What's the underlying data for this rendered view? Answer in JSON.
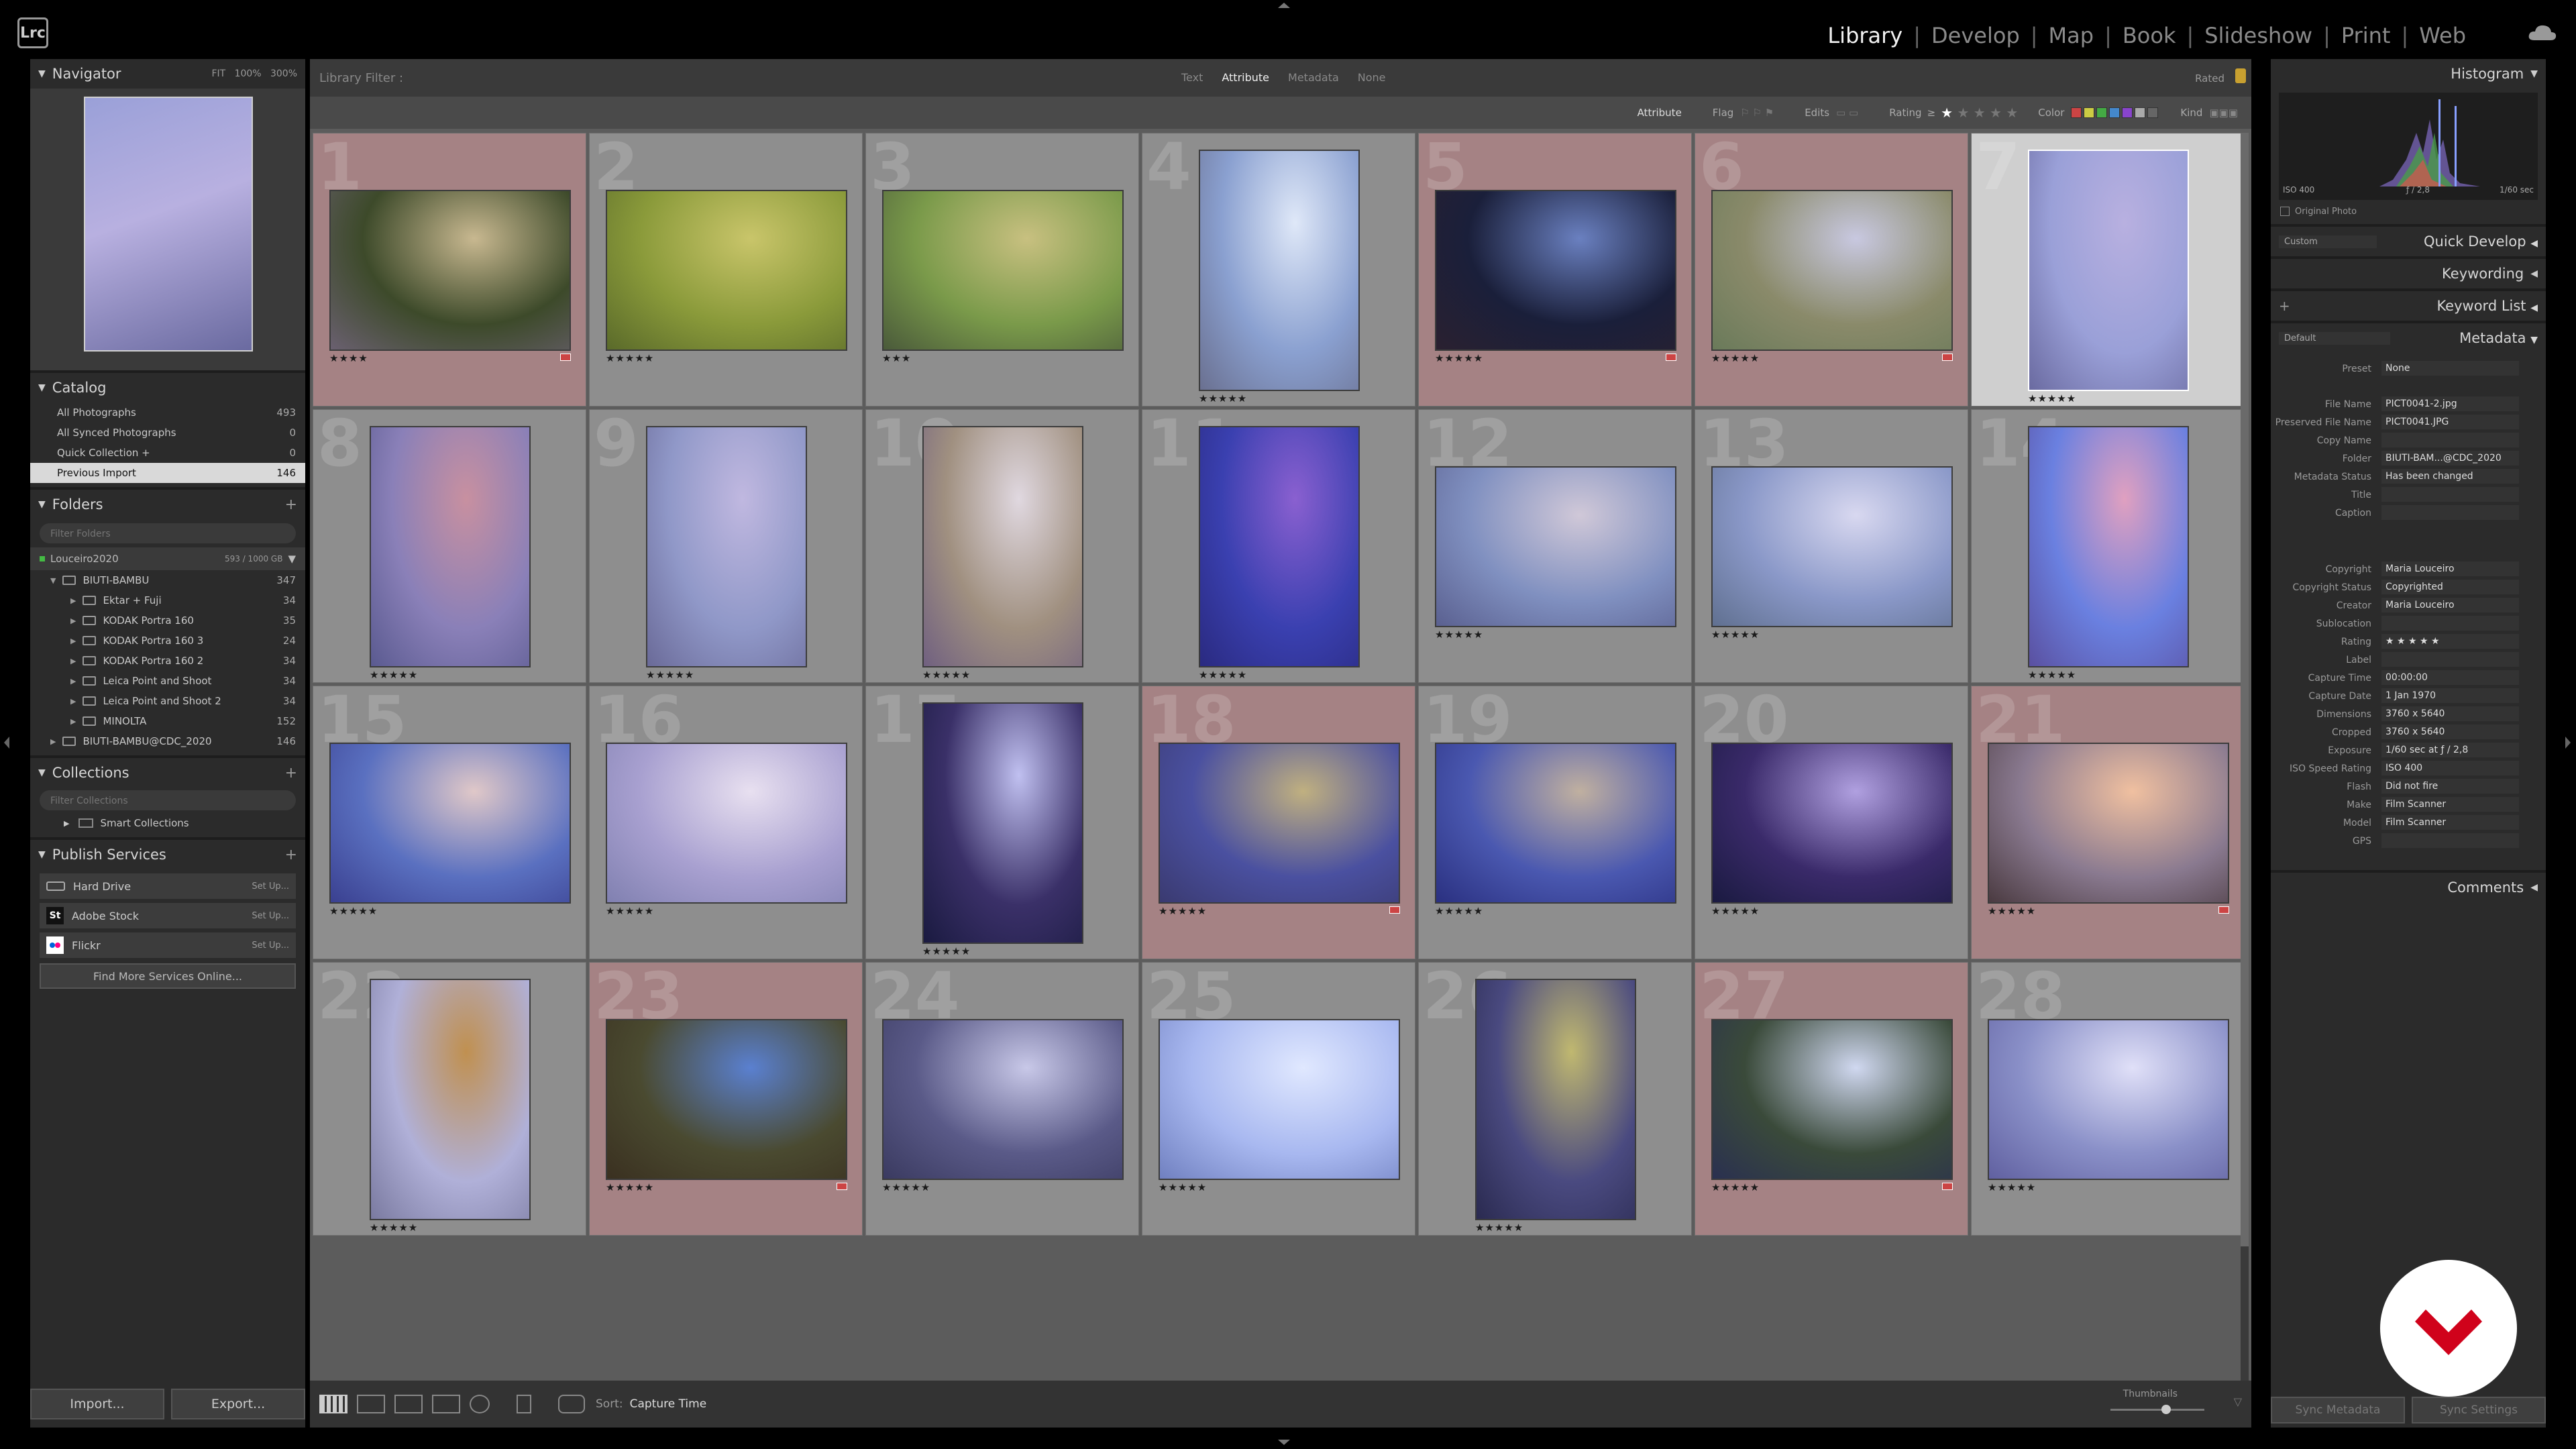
{
  "app": {
    "logo_text": "Lrc"
  },
  "modules": [
    "Library",
    "Develop",
    "Map",
    "Book",
    "Slideshow",
    "Print",
    "Web"
  ],
  "active_module": "Library",
  "left_panel": {
    "navigator": {
      "title": "Navigator",
      "zoom": [
        "FIT",
        "100%",
        "300%"
      ]
    },
    "catalog": {
      "title": "Catalog",
      "items": [
        {
          "label": "All Photographs",
          "count": "493"
        },
        {
          "label": "All Synced Photographs",
          "count": "0"
        },
        {
          "label": "Quick Collection +",
          "count": "0"
        },
        {
          "label": "Previous Import",
          "count": "146"
        }
      ]
    },
    "folders": {
      "title": "Folders",
      "filter_placeholder": "Filter Folders",
      "volume": {
        "name": "Louceiro2020",
        "space": "593 / 1000 GB"
      },
      "items": [
        {
          "label": "BIUTI-BAMBU",
          "count": "347"
        },
        {
          "label": "Ektar + Fuji",
          "count": "34"
        },
        {
          "label": "KODAK Portra 160",
          "count": "35"
        },
        {
          "label": "KODAK Portra 160 3",
          "count": "24"
        },
        {
          "label": "KODAK Portra 160 2",
          "count": "34"
        },
        {
          "label": "Leica Point and Shoot",
          "count": "34"
        },
        {
          "label": "Leica Point and Shoot 2",
          "count": "34"
        },
        {
          "label": "MINOLTA",
          "count": "152"
        },
        {
          "label": "BIUTI-BAMBU@CDC_2020",
          "count": "146"
        }
      ]
    },
    "collections": {
      "title": "Collections",
      "filter_placeholder": "Filter Collections",
      "smart": "Smart Collections"
    },
    "publish": {
      "title": "Publish Services",
      "services": [
        {
          "label": "Hard Drive",
          "action": "Set Up..."
        },
        {
          "label": "Adobe Stock",
          "action": "Set Up..."
        },
        {
          "label": "Flickr",
          "action": "Set Up..."
        }
      ],
      "find_more": "Find More Services Online..."
    },
    "import_label": "Import...",
    "export_label": "Export..."
  },
  "filter_bar": {
    "title": "Library Filter :",
    "tabs": [
      "Text",
      "Attribute",
      "Metadata",
      "None"
    ],
    "active_tab": "Attribute",
    "preset": "Rated",
    "attribute_label": "Attribute",
    "flag_label": "Flag",
    "edits_label": "Edits",
    "rating_label": "Rating",
    "rating_op": "≥",
    "color_label": "Color",
    "kind_label": "Kind",
    "color_swatches": [
      "#c44",
      "#cc4",
      "#4a4",
      "#48c",
      "#84c",
      "#aaa",
      "#666"
    ]
  },
  "grid": {
    "cells": [
      {
        "num": "1",
        "stars": "★★★★",
        "pink": true,
        "flag": true,
        "orient": "land",
        "colors": [
          "#3d4a2a",
          "#c8b890",
          "#6a6070"
        ]
      },
      {
        "num": "2",
        "stars": "★★★★★",
        "pink": false,
        "flag": false,
        "orient": "land",
        "colors": [
          "#8a9a3a",
          "#c9c56a",
          "#5a6a2a"
        ]
      },
      {
        "num": "3",
        "stars": "★★★",
        "pink": false,
        "flag": false,
        "orient": "land",
        "colors": [
          "#7a9a4a",
          "#c8c080",
          "#4a5a3a"
        ]
      },
      {
        "num": "4",
        "stars": "★★★★★",
        "pink": false,
        "flag": false,
        "orient": "port",
        "colors": [
          "#8aa0d0",
          "#dfe8f8",
          "#6a7090"
        ]
      },
      {
        "num": "5",
        "stars": "★★★★★",
        "pink": true,
        "flag": true,
        "orient": "land",
        "colors": [
          "#1a1f3a",
          "#6a80c0",
          "#2a2030"
        ]
      },
      {
        "num": "6",
        "stars": "★★★★★",
        "pink": true,
        "flag": true,
        "orient": "land",
        "colors": [
          "#8a8a6a",
          "#c8c8e0",
          "#6a7a5a"
        ]
      },
      {
        "num": "7",
        "stars": "★★★★★",
        "pink": false,
        "flag": false,
        "orient": "port",
        "selected": true,
        "colors": [
          "#9aa0d8",
          "#b8b0e0",
          "#6a6aa0"
        ]
      },
      {
        "num": "8",
        "stars": "★★★★★",
        "pink": false,
        "flag": false,
        "orient": "port",
        "colors": [
          "#8a80b8",
          "#c890a0",
          "#5a5a90"
        ]
      },
      {
        "num": "9",
        "stars": "★★★★★",
        "pink": false,
        "flag": false,
        "orient": "port",
        "colors": [
          "#9098c8",
          "#c0b8e0",
          "#6a6a98"
        ]
      },
      {
        "num": "10",
        "stars": "★★★★★",
        "pink": false,
        "flag": false,
        "orient": "port",
        "colors": [
          "#a09080",
          "#e0d8e0",
          "#706080"
        ]
      },
      {
        "num": "11",
        "stars": "★★★★★",
        "pink": false,
        "flag": false,
        "orient": "port",
        "colors": [
          "#3a40b0",
          "#8a60d0",
          "#2a2a80"
        ]
      },
      {
        "num": "12",
        "stars": "★★★★★",
        "pink": false,
        "flag": false,
        "orient": "land",
        "colors": [
          "#8090c0",
          "#d0c8d8",
          "#5a6090"
        ]
      },
      {
        "num": "13",
        "stars": "★★★★★",
        "pink": false,
        "flag": false,
        "orient": "land",
        "colors": [
          "#8a98c8",
          "#d8d8f0",
          "#607090"
        ]
      },
      {
        "num": "14",
        "stars": "★★★★★",
        "pink": false,
        "flag": false,
        "orient": "port",
        "colors": [
          "#6a80e0",
          "#e0a0c0",
          "#5a50a0"
        ]
      },
      {
        "num": "15",
        "stars": "★★★★★",
        "pink": false,
        "flag": false,
        "orient": "land",
        "colors": [
          "#5a70c0",
          "#e0c8c8",
          "#3a4090"
        ]
      },
      {
        "num": "16",
        "stars": "★★★★★",
        "pink": false,
        "flag": false,
        "orient": "land",
        "colors": [
          "#a8a0d0",
          "#e8e0f0",
          "#8080b0"
        ]
      },
      {
        "num": "17",
        "stars": "★★★★★",
        "pink": false,
        "flag": false,
        "orient": "port",
        "colors": [
          "#3a3068",
          "#c0c0f0",
          "#1a1a40"
        ]
      },
      {
        "num": "18",
        "stars": "★★★★★",
        "pink": true,
        "flag": true,
        "orient": "land",
        "colors": [
          "#4a50a0",
          "#c0b080",
          "#3a3a70"
        ]
      },
      {
        "num": "19",
        "stars": "★★★★★",
        "pink": false,
        "flag": false,
        "orient": "land",
        "colors": [
          "#4a58b0",
          "#c0b0a0",
          "#2a3080"
        ]
      },
      {
        "num": "20",
        "stars": "★★★★★",
        "pink": false,
        "flag": false,
        "orient": "land",
        "colors": [
          "#3a2a6a",
          "#b0a0e0",
          "#1a1a40"
        ]
      },
      {
        "num": "21",
        "stars": "★★★★★",
        "pink": true,
        "flag": true,
        "orient": "land",
        "colors": [
          "#8a7a90",
          "#f0c0a0",
          "#4a3a40"
        ]
      },
      {
        "num": "22",
        "stars": "★★★★★",
        "pink": false,
        "flag": false,
        "orient": "port",
        "colors": [
          "#b0b0d8",
          "#c09050",
          "#7a7aa0"
        ]
      },
      {
        "num": "23",
        "stars": "★★★★★",
        "pink": true,
        "flag": true,
        "orient": "land",
        "colors": [
          "#4a4a30",
          "#5a80d0",
          "#3a3020"
        ]
      },
      {
        "num": "24",
        "stars": "★★★★★",
        "pink": false,
        "flag": false,
        "orient": "land",
        "colors": [
          "#5a5a88",
          "#c8c8e8",
          "#3a3a60"
        ]
      },
      {
        "num": "25",
        "stars": "★★★★★",
        "pink": false,
        "flag": false,
        "orient": "land",
        "colors": [
          "#a8b8f0",
          "#e0e8ff",
          "#7080c0"
        ]
      },
      {
        "num": "26",
        "stars": "★★★★★",
        "pink": false,
        "flag": false,
        "orient": "port",
        "colors": [
          "#4a4a80",
          "#c0b870",
          "#2a2a50"
        ]
      },
      {
        "num": "27",
        "stars": "★★★★★",
        "pink": true,
        "flag": true,
        "orient": "land",
        "colors": [
          "#3a4a3a",
          "#d0d8f0",
          "#2a3050"
        ]
      },
      {
        "num": "28",
        "stars": "★★★★★",
        "pink": false,
        "flag": false,
        "orient": "land",
        "colors": [
          "#8a90c8",
          "#e0e0f8",
          "#6060a0"
        ]
      }
    ]
  },
  "toolbar": {
    "sort_label": "Sort:",
    "sort_value": "Capture Time",
    "thumbnails_label": "Thumbnails"
  },
  "right_panel": {
    "histogram": {
      "title": "Histogram",
      "iso": "ISO 400",
      "aperture": "ƒ / 2,8",
      "shutter": "1/60 sec",
      "original_photo": "Original Photo"
    },
    "quick_develop": {
      "title": "Quick Develop",
      "preset": "Custom"
    },
    "keywording": {
      "title": "Keywording"
    },
    "keyword_list": {
      "title": "Keyword List"
    },
    "metadata": {
      "title": "Metadata",
      "preset_select": "Default",
      "preset_label": "Preset",
      "preset_value": "None",
      "fields": [
        {
          "label": "File Name",
          "value": "PICT0041-2.jpg"
        },
        {
          "label": "Preserved File Name",
          "value": "PICT0041.JPG"
        },
        {
          "label": "Copy Name",
          "value": ""
        },
        {
          "label": "Folder",
          "value": "BIUTI-BAM...@CDC_2020"
        },
        {
          "label": "Metadata Status",
          "value": "Has been changed"
        },
        {
          "label": "Title",
          "value": ""
        },
        {
          "label": "Caption",
          "value": ""
        },
        {
          "label": "Copyright",
          "value": "Maria Louceiro"
        },
        {
          "label": "Copyright Status",
          "value": "Copyrighted"
        },
        {
          "label": "Creator",
          "value": "Maria Louceiro"
        },
        {
          "label": "Sublocation",
          "value": ""
        },
        {
          "label": "Rating",
          "value": "★ ★ ★ ★ ★"
        },
        {
          "label": "Label",
          "value": ""
        },
        {
          "label": "Capture Time",
          "value": "00:00:00"
        },
        {
          "label": "Capture Date",
          "value": "1 Jan 1970"
        },
        {
          "label": "Dimensions",
          "value": "3760 x 5640"
        },
        {
          "label": "Cropped",
          "value": "3760 x 5640"
        },
        {
          "label": "Exposure",
          "value": "1/60 sec at ƒ / 2,8"
        },
        {
          "label": "ISO Speed Rating",
          "value": "ISO 400"
        },
        {
          "label": "Flash",
          "value": "Did not fire"
        },
        {
          "label": "Make",
          "value": "Film Scanner"
        },
        {
          "label": "Model",
          "value": "Film Scanner"
        },
        {
          "label": "GPS",
          "value": ""
        }
      ]
    },
    "comments": {
      "title": "Comments"
    },
    "sync_metadata": "Sync Metadata",
    "sync_settings": "Sync Settings"
  },
  "colors": {
    "accent_pink": "#a58284",
    "cell_gray": "#8e8e8e",
    "panel": "#2b2b2b",
    "brand_red": "#d0021b"
  }
}
